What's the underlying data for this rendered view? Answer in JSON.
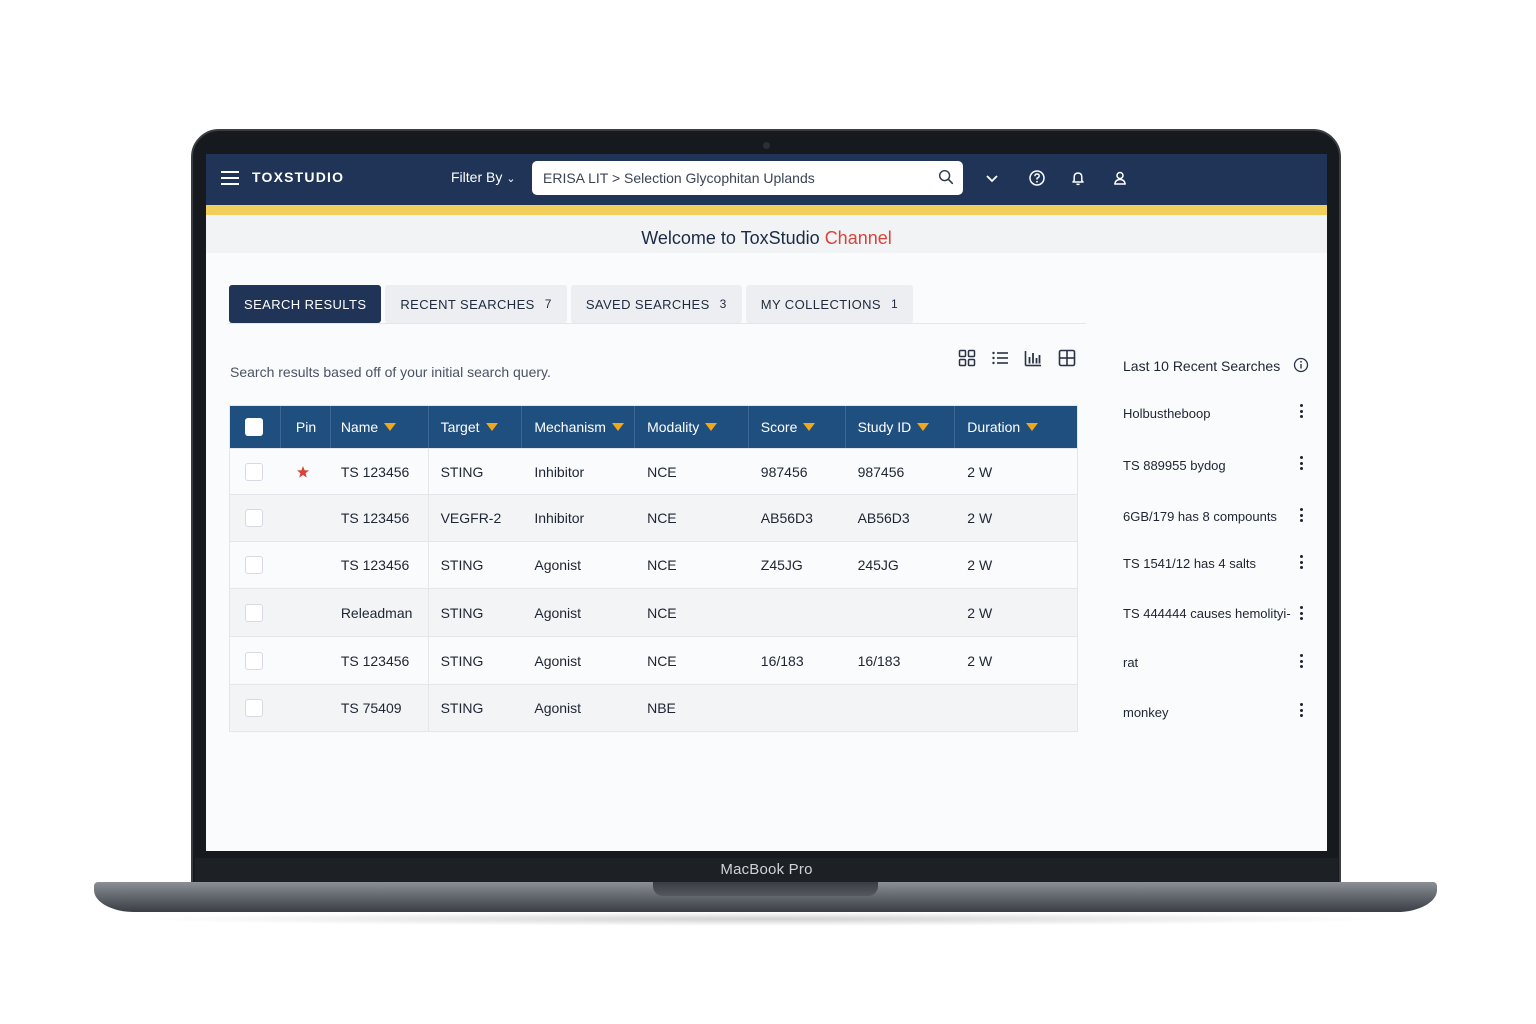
{
  "device": {
    "label": "MacBook Pro"
  },
  "app": {
    "brand": "TOXSTUDIO"
  },
  "header": {
    "filter_label": "Filter By",
    "search_value": "ERISA LIT > Selection Glycophitan Uplands",
    "icons": [
      "menu-icon",
      "search-icon",
      "chevron-down-icon",
      "help-icon",
      "bell-icon",
      "user-icon"
    ]
  },
  "welcome": {
    "text": "Welcome to ToxStudio",
    "accent": "Channel"
  },
  "tabs": [
    {
      "label": "SEARCH RESULTS",
      "count": "",
      "active": true
    },
    {
      "label": "RECENT SEARCHES",
      "count": "7",
      "active": false
    },
    {
      "label": "SAVED SEARCHES",
      "count": "3",
      "active": false
    },
    {
      "label": "MY COLLECTIONS",
      "count": "1",
      "active": false
    }
  ],
  "results": {
    "caption": "Search results based off of your initial search query.",
    "view_icons": [
      "grid-view-icon",
      "list-view-icon",
      "chart-view-icon",
      "table-view-icon"
    ]
  },
  "table": {
    "columns": [
      "Pin",
      "Name",
      "Target",
      "Mechanism",
      "Modality",
      "Score",
      "Study ID",
      "Duration"
    ],
    "rows": [
      {
        "pinned": true,
        "name": "TS 123456",
        "target": "STING",
        "mechanism": "Inhibitor",
        "modality": "NCE",
        "score": "987456",
        "study_id": "987456",
        "duration": "2 W"
      },
      {
        "pinned": false,
        "name": "TS 123456",
        "target": "VEGFR-2",
        "mechanism": "Inhibitor",
        "modality": "NCE",
        "score": "AB56D3",
        "study_id": "AB56D3",
        "duration": "2 W"
      },
      {
        "pinned": false,
        "name": "TS 123456",
        "target": "STING",
        "mechanism": "Agonist",
        "modality": "NCE",
        "score": "Z45JG",
        "study_id": "245JG",
        "duration": "2 W"
      },
      {
        "pinned": false,
        "name": "Releadman",
        "target": "STING",
        "mechanism": "Agonist",
        "modality": "NCE",
        "score": "",
        "study_id": "",
        "duration": "2 W"
      },
      {
        "pinned": false,
        "name": "TS 123456",
        "target": "STING",
        "mechanism": "Agonist",
        "modality": "NCE",
        "score": "16/183",
        "study_id": "16/183",
        "duration": "2 W"
      },
      {
        "pinned": false,
        "name": "TS 75409",
        "target": "STING",
        "mechanism": "Agonist",
        "modality": "NBE",
        "score": "",
        "study_id": "",
        "duration": ""
      }
    ]
  },
  "recent": {
    "title": "Last 10 Recent Searches",
    "items": [
      "Holbustheboop",
      "TS 889955 bydog",
      "6GB/179 has 8 compounts",
      "TS 1541/12 has 4 salts",
      "TS 444444 causes hemolityi-",
      "rat",
      "monkey"
    ]
  },
  "colors": {
    "header": "#1f3456",
    "stripe": "#f2cf5b",
    "table_header": "#1f4f7f",
    "sort_arrow": "#f2a619",
    "accent": "#d8443b",
    "pin": "#d8443b"
  }
}
